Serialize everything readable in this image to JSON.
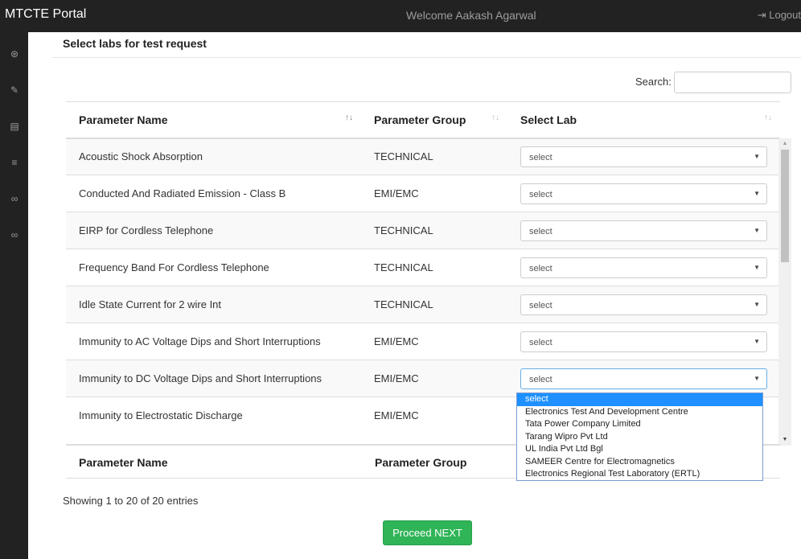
{
  "header": {
    "brand": "MTCTE Portal",
    "welcome": "Welcome Aakash Agarwal",
    "logout": "Logout"
  },
  "sidebar": {
    "icons": [
      "dashboard-icon",
      "wrench-icon",
      "file-icon",
      "list-icon",
      "link-icon",
      "link-icon-2"
    ]
  },
  "page": {
    "heading": "Select labs for test request",
    "search_label": "Search:",
    "search_value": ""
  },
  "table": {
    "columns": [
      "Parameter Name",
      "Parameter Group",
      "Select Lab"
    ],
    "sort_glyph": "↑↓",
    "rows": [
      {
        "name": "Acoustic Shock Absorption",
        "group": "TECHNICAL",
        "lab": "select"
      },
      {
        "name": "Conducted And Radiated Emission - Class B",
        "group": "EMI/EMC",
        "lab": "select"
      },
      {
        "name": "EIRP for Cordless Telephone",
        "group": "TECHNICAL",
        "lab": "select"
      },
      {
        "name": "Frequency Band For Cordless Telephone",
        "group": "TECHNICAL",
        "lab": "select"
      },
      {
        "name": "Idle State Current for 2 wire Int",
        "group": "TECHNICAL",
        "lab": "select"
      },
      {
        "name": "Immunity to AC Voltage Dips and Short Interruptions",
        "group": "EMI/EMC",
        "lab": "select"
      },
      {
        "name": "Immunity to DC Voltage Dips and Short Interruptions",
        "group": "EMI/EMC",
        "lab": "select"
      },
      {
        "name": "Immunity to Electrostatic Discharge",
        "group": "EMI/EMC",
        "lab": ""
      }
    ],
    "footer_columns": [
      "Parameter Name",
      "Parameter Group"
    ]
  },
  "dropdown": {
    "options": [
      "select",
      "Electronics Test And Development Centre",
      "Tata Power Company Limited",
      "Tarang Wipro Pvt Ltd",
      "UL India Pvt Ltd Bgl",
      "SAMEER Centre for Electromagnetics",
      "Electronics Regional Test Laboratory (ERTL)"
    ],
    "highlighted": "select"
  },
  "info": "Showing 1 to 20 of 20 entries",
  "proceed_label": "Proceed NEXT",
  "colors": {
    "topbar": "#222222",
    "button": "#2fb457",
    "highlight": "#1e90ff"
  }
}
